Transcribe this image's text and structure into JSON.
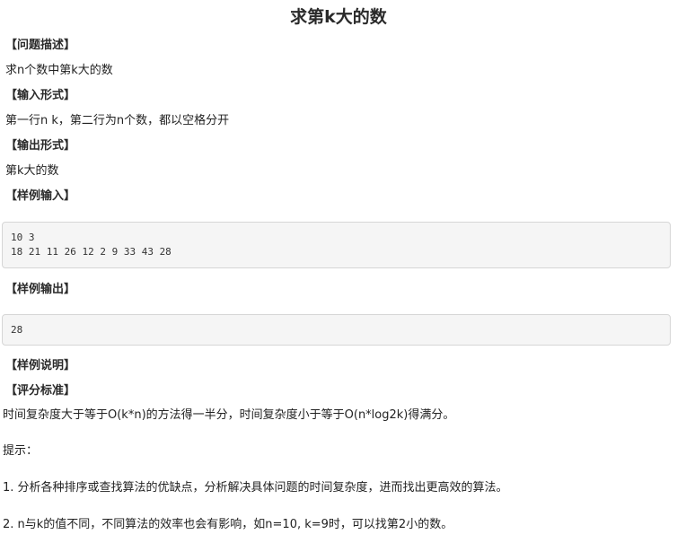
{
  "title": "求第k大的数",
  "sections": {
    "problem_heading": "【问题描述】",
    "problem_text": "求n个数中第k大的数",
    "input_heading": "【输入形式】",
    "input_text": "第一行n k，第二行为n个数，都以空格分开",
    "output_heading": "【输出形式】",
    "output_text": "第k大的数",
    "sample_input_heading": "【样例输入】",
    "sample_input_lines": [
      "10 3",
      "18 21 11 26 12 2 9 33 43 28"
    ],
    "sample_output_heading": "【样例输出】",
    "sample_output_lines": [
      "28"
    ],
    "sample_explain_heading": "【样例说明】",
    "scoring_heading": "【评分标准】",
    "scoring_text": "时间复杂度大于等于O(k*n)的方法得一半分，时间复杂度小于等于O(n*log2k)得满分。",
    "hint_label": "提示：",
    "hint_1": "1. 分析各种排序或查找算法的优缺点，分析解决具体问题的时间复杂度，进而找出更高效的算法。",
    "hint_2": "2. n与k的值不同，不同算法的效率也会有影响，如n=10, k=9时，可以找第2小的数。"
  }
}
